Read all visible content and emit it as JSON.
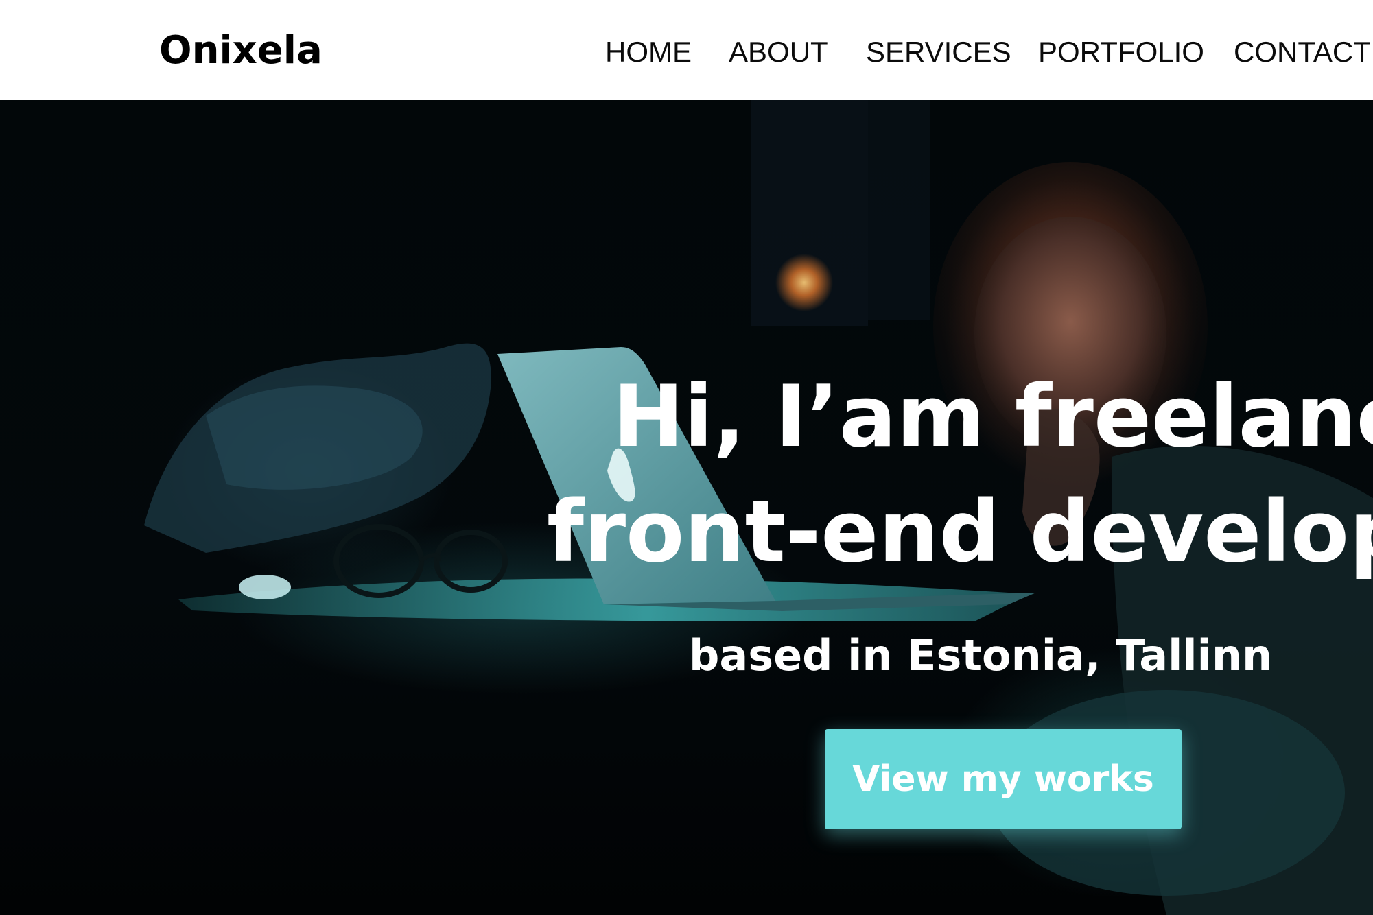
{
  "brand": {
    "name": "Onixela"
  },
  "nav": {
    "items": [
      {
        "label": "HOME"
      },
      {
        "label": "ABOUT"
      },
      {
        "label": "SERVICES"
      },
      {
        "label": "PORTFOLIO"
      },
      {
        "label": "CONTACT"
      }
    ]
  },
  "hero": {
    "headline_line1": "Hi, I’am freelancer",
    "headline_line2": "front-end developer",
    "subline": "based in Estonia, Tallinn",
    "cta_label": "View my works",
    "image_alt": "woman working on a laptop in a dark room",
    "colors": {
      "accent": "#67d8d9",
      "text": "#ffffff",
      "header_bg": "#ffffff"
    }
  }
}
